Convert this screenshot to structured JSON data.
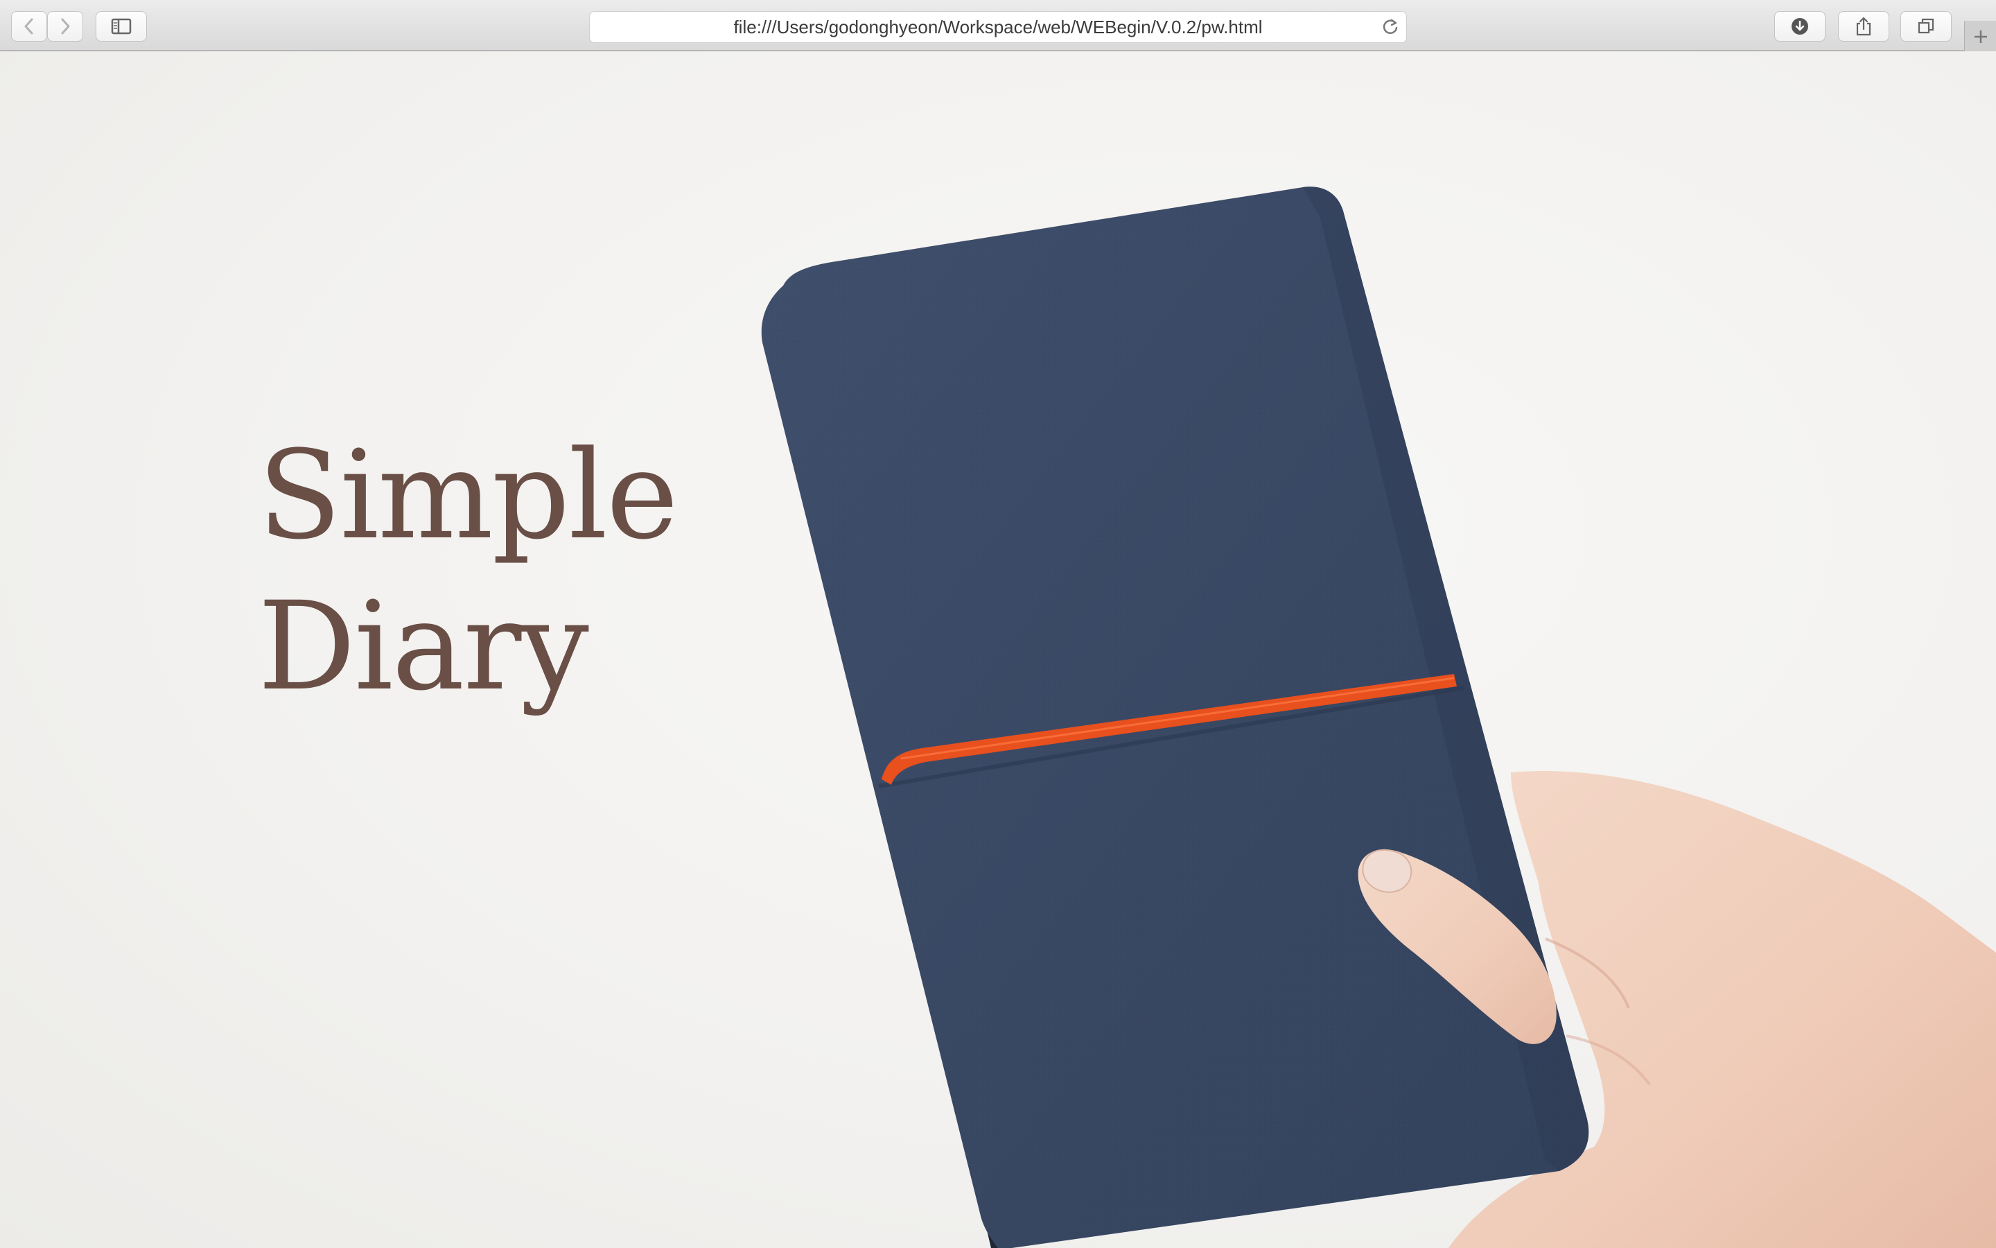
{
  "browser": {
    "url": "file:///Users/godonghyeon/Workspace/web/WEBegin/V.0.2/pw.html",
    "icons": {
      "back": "chevron-left-icon",
      "forward": "chevron-right-icon",
      "sidebar": "sidebar-icon",
      "reload": "reload-icon",
      "downloads": "download-icon",
      "share": "share-icon",
      "tabs": "tabs-overview-icon",
      "new_tab": "plus-icon"
    }
  },
  "page": {
    "title_line1": "Simple",
    "title_line2": "Diary"
  },
  "colors": {
    "title": "#6a4f46",
    "notebook": "#3a4a66",
    "band": "#e8501e",
    "background": "#f4f3f1"
  }
}
